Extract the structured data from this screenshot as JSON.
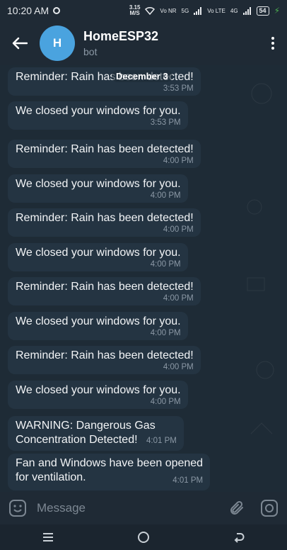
{
  "status_bar": {
    "time": "10:20 AM",
    "speed_value": "3.15",
    "speed_unit": "M/S",
    "network_1": "Vo NR",
    "network_2": "5G",
    "network_3": "Vo LTE",
    "network_4": "4G",
    "battery": "54"
  },
  "header": {
    "avatar_letter": "H",
    "title": "HomeESP32",
    "subtitle": "bot"
  },
  "chat": {
    "date_label": "December 3",
    "messages": [
      {
        "text": "Reminder: Rain has been detected!",
        "time": "3:53 PM"
      },
      {
        "text": "We closed your windows for you.",
        "time": "3:53 PM"
      },
      {
        "text": "Reminder: Rain has been detected!",
        "time": "4:00 PM"
      },
      {
        "text": "We closed your windows for you.",
        "time": "4:00 PM"
      },
      {
        "text": "Reminder: Rain has been detected!",
        "time": "4:00 PM"
      },
      {
        "text": "We closed your windows for you.",
        "time": "4:00 PM"
      },
      {
        "text": "Reminder: Rain has been detected!",
        "time": "4:00 PM"
      },
      {
        "text": "We closed your windows for you.",
        "time": "4:00 PM"
      },
      {
        "text": "Reminder: Rain has been detected!",
        "time": "4:00 PM"
      },
      {
        "text": "We closed your windows for you.",
        "time": "4:00 PM"
      },
      {
        "text_line1": "WARNING: Dangerous Gas",
        "text_line2": "Concentration Detected!",
        "time": "4:01 PM"
      },
      {
        "text_line1": "Fan and Windows have been opened",
        "text_line2": "for ventilation.",
        "time": "4:01 PM"
      }
    ]
  },
  "composer": {
    "placeholder": "Message"
  },
  "colors": {
    "background": "#1e2b36",
    "bubble": "#243442",
    "header": "#1f2a35",
    "avatar": "#4aa3df"
  },
  "icons": [
    "back-arrow-icon",
    "more-vertical-icon",
    "emoji-icon",
    "attach-icon",
    "camera-icon",
    "menu-nav-icon",
    "home-nav-icon",
    "back-nav-icon"
  ]
}
